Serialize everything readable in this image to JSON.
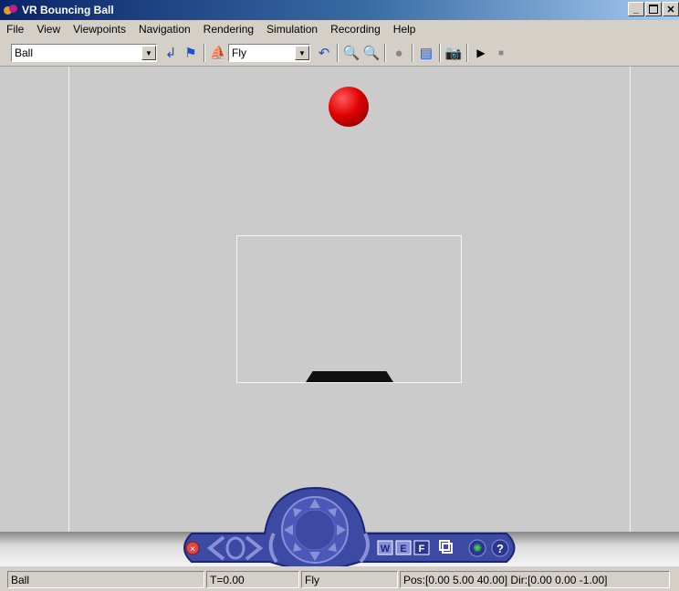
{
  "window": {
    "title": "VR Bouncing Ball"
  },
  "menu": [
    "File",
    "View",
    "Viewpoints",
    "Navigation",
    "Rendering",
    "Simulation",
    "Recording",
    "Help"
  ],
  "toolbar": {
    "viewpoint_value": "Ball",
    "nav_mode_value": "Fly"
  },
  "navpanel": {
    "w_label": "W",
    "e_label": "E",
    "f_label": "F",
    "help_label": "?"
  },
  "status": {
    "viewpoint": "Ball",
    "time": "T=0.00",
    "mode": "Fly",
    "position": "Pos:[0.00 5.00 40.00] Dir:[0.00 0.00 -1.00]"
  }
}
